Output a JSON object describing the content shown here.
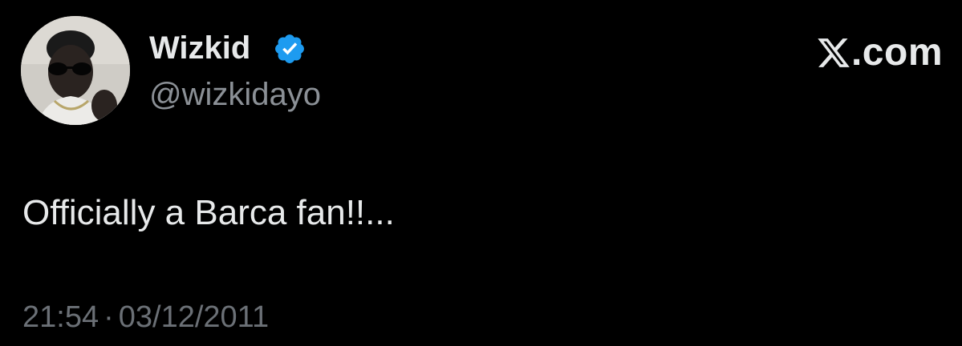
{
  "author": {
    "display_name": "Wizkid",
    "handle": "@wizkidayo",
    "verified": true,
    "verified_color": "#1d9bf0"
  },
  "brand": {
    "logo_icon": "x-logo-icon",
    "suffix": ".com"
  },
  "tweet": {
    "text": "Officially a Barca fan!!...",
    "time": "21:54",
    "separator": "·",
    "date": "03/12/2011"
  },
  "colors": {
    "background": "#000000",
    "primary_text": "#e7e9ea",
    "secondary_text": "#8b9096"
  }
}
